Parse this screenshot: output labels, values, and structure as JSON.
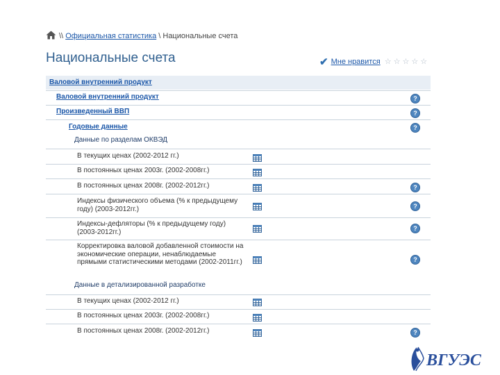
{
  "breadcrumb": {
    "separator1": "\\\\",
    "link": "Официальная статистика",
    "separator2": "\\",
    "current": "Национальные счета"
  },
  "page": {
    "title": "Национальные счета"
  },
  "rating": {
    "label": "Мне нравится",
    "stars": 5
  },
  "tree": {
    "level0": "Валовой внутренний продукт",
    "level1a": "Валовой внутренний продукт",
    "level1b": "Произведенный ВВП",
    "level2": "Годовые данные",
    "section1": "Данные по разделам ОКВЭД",
    "section1_rows": [
      {
        "text": "В текущих ценах (2002-2012 гг.)",
        "help": false
      },
      {
        "text": "В постоянных ценах 2003г. (2002-2008гг.)",
        "help": false
      },
      {
        "text": "В постоянных ценах 2008г. (2002-2012гг.)",
        "help": true
      },
      {
        "text": "Индексы физического объема (% к предыдущему году) (2003-2012гг.)",
        "help": true
      },
      {
        "text": "Индексы-дефляторы (% к предыдущему году) (2003-2012гг.)",
        "help": true
      },
      {
        "text": "Корректировка валовой добавленной стоимости на экономические операции, ненаблюдаемые прямыми статистическими методами (2002-2011гг.)",
        "help": true
      }
    ],
    "section2": "Данные в детализированной разработке",
    "section2_rows": [
      {
        "text": "В текущих ценах (2002-2012 гг.)",
        "help": false
      },
      {
        "text": "В постоянных ценах 2003г. (2002-2008гг.)",
        "help": false
      },
      {
        "text": "В постоянных ценах 2008г. (2002-2012гг.)",
        "help": true
      }
    ]
  },
  "icons": {
    "help": "question-mark",
    "table": "table-icon",
    "home": "home-icon",
    "check": "checkmark-icon"
  },
  "colors": {
    "link": "#1a56a8",
    "title": "#2f5f8f",
    "row_bg": "#e8eef5",
    "help": "#4f86bf"
  },
  "logo": {
    "text": "ВГУЭС"
  }
}
